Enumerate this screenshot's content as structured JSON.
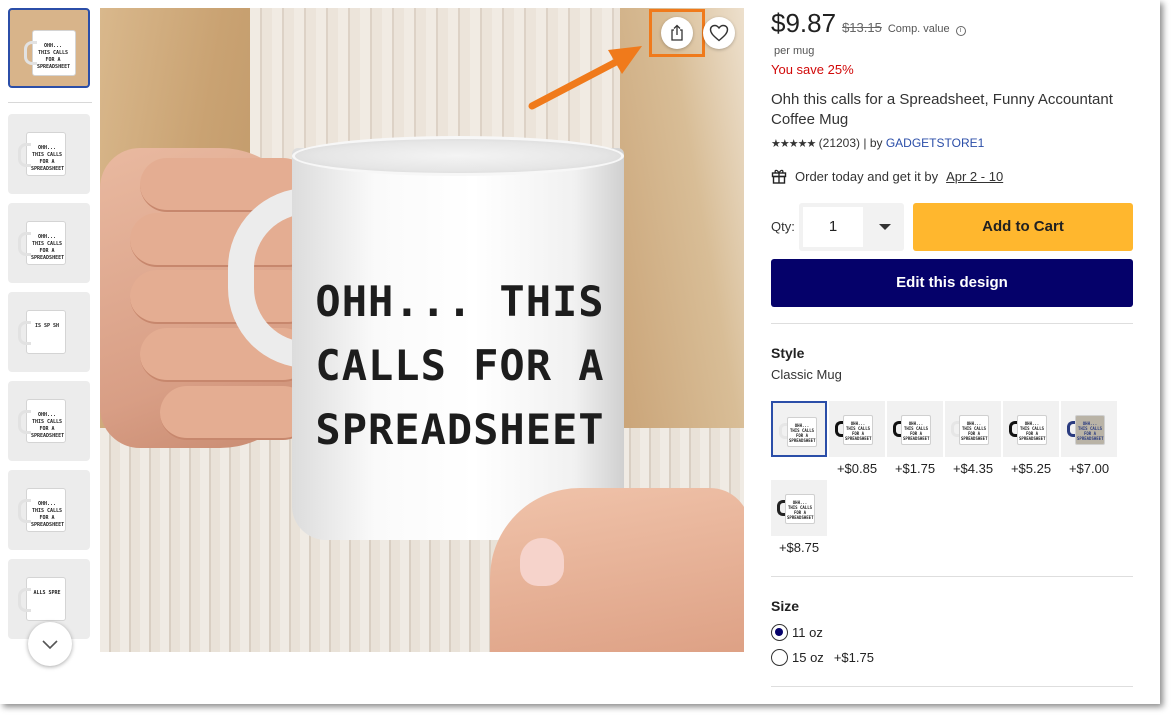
{
  "colors": {
    "accent_orange": "#f07a1b",
    "add_to_cart": "#ffb72e",
    "edit_design": "#05016a",
    "save_red": "#d10808",
    "link_blue": "#2b4ea8"
  },
  "thumbnails": [
    {
      "kind": "lifestyle",
      "text": "OHH... THIS CALLS FOR A SPREADSHEET",
      "active": true
    },
    {
      "kind": "product",
      "text": "OHH... THIS CALLS FOR A SPREADSHEET"
    },
    {
      "kind": "product",
      "text": "OHH... THIS CALLS FOR A SPREADSHEET"
    },
    {
      "kind": "product",
      "text": "IS SP SH"
    },
    {
      "kind": "product",
      "text": "OHH... THIS CALLS FOR A SPREADSHEET"
    },
    {
      "kind": "product",
      "text": "OHH... THIS CALLS FOR A SPREADSHEET"
    },
    {
      "kind": "product",
      "text": "ALLS SPRE"
    }
  ],
  "main_image": {
    "mug_text_line1": "OHH... THIS",
    "mug_text_line2": "CALLS FOR A",
    "mug_text_line3": "SPREADSHEET"
  },
  "icons": {
    "share": "share-icon",
    "favorite": "heart-icon",
    "scroll_down": "chevron-down-icon",
    "gift": "gift-icon",
    "info": "info-icon"
  },
  "product": {
    "price": "$9.87",
    "old_price": "$13.15",
    "comp_label": "Comp. value",
    "info_glyph": "i",
    "per_unit": "per mug",
    "save_text": "You save 25%",
    "title": "Ohh this calls for a Spreadsheet, Funny Accountant Coffee Mug",
    "stars": "★★★★★",
    "review_count": "(21203)",
    "by_text": "| by",
    "store": "GADGETSTORE1",
    "ship_text": "Order today and get it by",
    "ship_date": "Apr 2 - 10"
  },
  "purchase": {
    "qty_label": "Qty:",
    "qty_value": "1",
    "add_to_cart": "Add to Cart",
    "edit_design": "Edit this design"
  },
  "style": {
    "label": "Style",
    "selected_value": "Classic Mug",
    "options": [
      {
        "price": "",
        "mug": "#ffffff",
        "handle": "#e6e6e6",
        "text": "#222222"
      },
      {
        "price": "+$0.85",
        "mug": "#ffffff",
        "handle": "#111111",
        "text": "#222222"
      },
      {
        "price": "+$1.75",
        "mug": "#ffffff",
        "handle": "#111111",
        "text": "#222222"
      },
      {
        "price": "+$4.35",
        "mug": "#ffffff",
        "handle": "#e6e6e6",
        "text": "#222222"
      },
      {
        "price": "+$5.25",
        "mug": "#ffffff",
        "handle": "#111111",
        "text": "#222222"
      },
      {
        "price": "+$7.00",
        "mug": "#b9b3a6",
        "handle": "#2b3c80",
        "text": "#2b3c80"
      },
      {
        "price": "+$8.75",
        "mug": "#ffffff",
        "handle": "#222222",
        "text": "#222222"
      }
    ]
  },
  "size": {
    "label": "Size",
    "options": [
      {
        "label": "11 oz",
        "extra": "",
        "checked": true
      },
      {
        "label": "15 oz",
        "extra": "+$1.75",
        "checked": false
      }
    ]
  }
}
